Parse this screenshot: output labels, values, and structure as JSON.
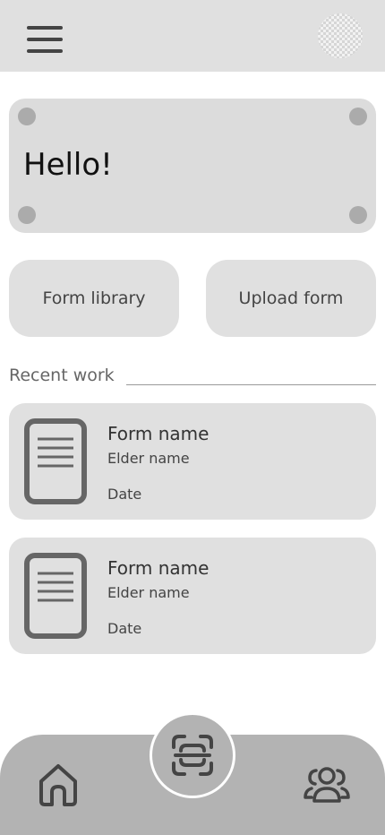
{
  "header": {
    "menu_icon": "hamburger-menu-icon",
    "avatar_icon": "user-avatar"
  },
  "greeting": {
    "text": "Hello!"
  },
  "actions": {
    "form_library_label": "Form library",
    "upload_form_label": "Upload form"
  },
  "recent": {
    "heading": "Recent work",
    "items": [
      {
        "form_name": "Form name",
        "elder_name": "Elder name",
        "date": "Date",
        "icon": "document-icon"
      },
      {
        "form_name": "Form name",
        "elder_name": "Elder name",
        "date": "Date",
        "icon": "document-icon"
      }
    ]
  },
  "bottom_nav": {
    "home_icon": "home-icon",
    "scan_icon": "scan-icon",
    "people_icon": "people-icon"
  },
  "colors": {
    "header_bg": "#e0e0e0",
    "card_bg": "#e0e0e0",
    "nav_bg": "#b3b3b3",
    "icon_color": "#666666"
  }
}
